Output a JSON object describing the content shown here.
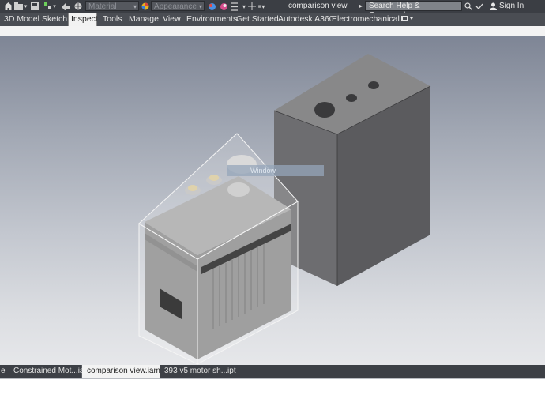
{
  "titlebar": {
    "material_placeholder": "Material",
    "appearance_placeholder": "Appearance",
    "document_title": "comparison view",
    "search_placeholder": "Search Help & Commands...",
    "sign_in": "Sign In"
  },
  "ribbon": {
    "tabs": [
      {
        "label": "3D Model"
      },
      {
        "label": "Sketch"
      },
      {
        "label": "Inspect"
      },
      {
        "label": "Tools"
      },
      {
        "label": "Manage"
      },
      {
        "label": "View"
      },
      {
        "label": "Environments"
      },
      {
        "label": "Get Started"
      },
      {
        "label": "Autodesk A360"
      },
      {
        "label": "Electromechanical"
      }
    ],
    "active_tab": "Inspect"
  },
  "viewport": {
    "hover_tip": "Window"
  },
  "document_tabs": [
    {
      "label": "e"
    },
    {
      "label": "Constrained Mot...iam"
    },
    {
      "label": "comparison view.iam"
    },
    {
      "label": "393 v5 motor sh...ipt"
    }
  ],
  "colors": {
    "titlebar": "#3b3e44",
    "ribbon": "#4a4d53",
    "viewport_top": "#7e8595",
    "viewport_bottom": "#e6e7ea",
    "block_right_face": "#5b5b5e",
    "block_left_face": "#6c6c6f",
    "block_top_face": "#868689"
  }
}
